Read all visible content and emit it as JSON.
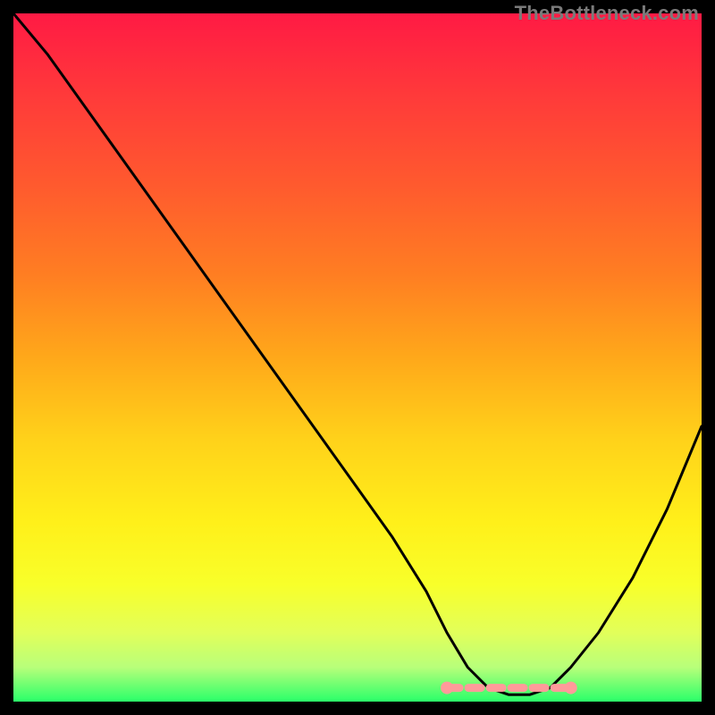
{
  "attribution": "TheBottleneck.com",
  "chart_data": {
    "type": "line",
    "title": "",
    "xlabel": "",
    "ylabel": "",
    "xlim": [
      0,
      100
    ],
    "ylim": [
      0,
      100
    ],
    "grid": false,
    "series": [
      {
        "name": "curve",
        "x": [
          0,
          5,
          10,
          15,
          20,
          25,
          30,
          35,
          40,
          45,
          50,
          55,
          60,
          63,
          66,
          69,
          72,
          75,
          78,
          81,
          85,
          90,
          95,
          100
        ],
        "values": [
          100,
          94,
          87,
          80,
          73,
          66,
          59,
          52,
          45,
          38,
          31,
          24,
          16,
          10,
          5,
          2,
          1,
          1,
          2,
          5,
          10,
          18,
          28,
          40
        ]
      },
      {
        "name": "basin-markers",
        "x": [
          63,
          66,
          69,
          72,
          75,
          78,
          81
        ],
        "values": [
          2,
          2,
          2,
          2,
          2,
          2,
          2
        ]
      }
    ],
    "gradient_stops": [
      {
        "offset": 0.0,
        "color": "#ff1a44"
      },
      {
        "offset": 0.12,
        "color": "#ff3a3a"
      },
      {
        "offset": 0.25,
        "color": "#ff5a2e"
      },
      {
        "offset": 0.38,
        "color": "#ff7e22"
      },
      {
        "offset": 0.5,
        "color": "#ffa81a"
      },
      {
        "offset": 0.62,
        "color": "#ffd21a"
      },
      {
        "offset": 0.74,
        "color": "#fff01a"
      },
      {
        "offset": 0.83,
        "color": "#f8ff2a"
      },
      {
        "offset": 0.9,
        "color": "#e2ff5a"
      },
      {
        "offset": 0.95,
        "color": "#b8ff7a"
      },
      {
        "offset": 1.0,
        "color": "#2aff6a"
      }
    ],
    "basin_color": "#ff9a9a"
  }
}
